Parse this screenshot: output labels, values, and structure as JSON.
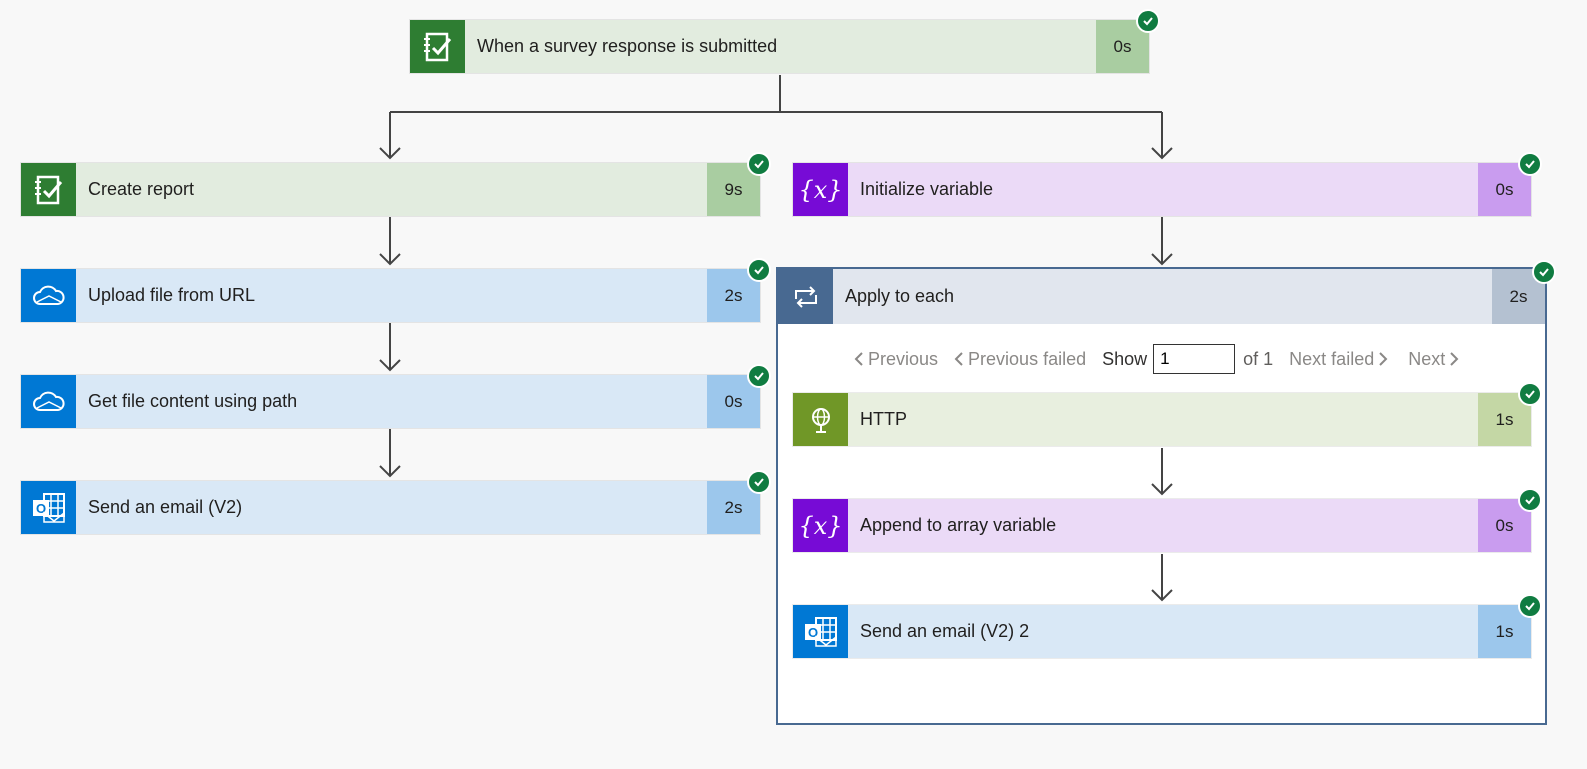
{
  "trigger": {
    "label": "When a survey response is submitted",
    "duration": "0s",
    "icon": "forms-icon"
  },
  "left_branch": [
    {
      "label": "Create report",
      "duration": "9s",
      "icon": "forms-icon"
    },
    {
      "label": "Upload file from URL",
      "duration": "2s",
      "icon": "onedrive-icon"
    },
    {
      "label": "Get file content using path",
      "duration": "0s",
      "icon": "onedrive-icon"
    },
    {
      "label": "Send an email (V2)",
      "duration": "2s",
      "icon": "outlook-icon"
    }
  ],
  "right_branch": {
    "init": {
      "label": "Initialize variable",
      "duration": "0s",
      "icon": "variable-icon"
    },
    "apply": {
      "label": "Apply to each",
      "duration": "2s",
      "icon": "loop-icon",
      "pager": {
        "previous": "Previous",
        "previous_failed": "Previous failed",
        "show": "Show",
        "value": "1",
        "of": "of 1",
        "next_failed": "Next failed",
        "next": "Next"
      },
      "actions": [
        {
          "label": "HTTP",
          "duration": "1s",
          "icon": "http-globe-icon"
        },
        {
          "label": "Append to array variable",
          "duration": "0s",
          "icon": "variable-icon"
        },
        {
          "label": "Send an email (V2) 2",
          "duration": "1s",
          "icon": "outlook-icon"
        }
      ]
    }
  },
  "colors": {
    "forms": "#2e7d32",
    "onedrive": "#0078d4",
    "variable": "#770bd6",
    "loop": "#486991",
    "http": "#709727",
    "success": "#107c41"
  }
}
